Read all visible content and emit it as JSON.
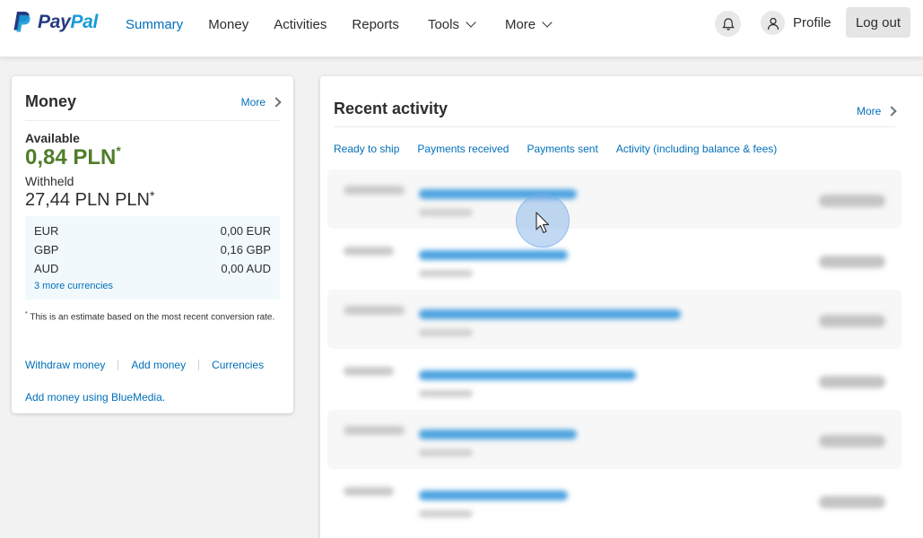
{
  "brand": {
    "name_pay": "Pay",
    "name_pal": "Pal",
    "logo_icon": "paypal-logo-icon"
  },
  "nav": {
    "items": [
      {
        "label": "Summary",
        "active": true
      },
      {
        "label": "Money"
      },
      {
        "label": "Activities"
      },
      {
        "label": "Reports"
      },
      {
        "label": "Tools",
        "dropdown": true
      },
      {
        "label": "More",
        "dropdown": true
      }
    ]
  },
  "header": {
    "bell_icon": "bell-icon",
    "profile_label": "Profile",
    "profile_icon": "user-icon",
    "logout_label": "Log out"
  },
  "money": {
    "title": "Money",
    "more_label": "More",
    "available_label": "Available",
    "available_value": "0,84 PLN",
    "withheld_label": "Withheld",
    "withheld_value": "27,44 PLN PLN",
    "asterisk": "*",
    "currencies": [
      {
        "code": "EUR",
        "amount": "0,00 EUR"
      },
      {
        "code": "GBP",
        "amount": "0,16 GBP"
      },
      {
        "code": "AUD",
        "amount": "0,00 AUD"
      }
    ],
    "more_currencies_label": "3 more currencies",
    "note": "This is an estimate based on the most recent conversion rate.",
    "actions": [
      "Withdraw money",
      "Add money",
      "Currencies"
    ],
    "bluemedia_label": "Add money using BlueMedia."
  },
  "activity": {
    "title": "Recent activity",
    "more_label": "More",
    "filters": [
      "Ready to ship",
      "Payments received",
      "Payments sent",
      "Activity (including balance & fees)"
    ]
  },
  "colors": {
    "accent": "#0070ba",
    "available_green": "#507d2a",
    "brand_dark": "#253b80",
    "brand_light": "#179bd7"
  }
}
